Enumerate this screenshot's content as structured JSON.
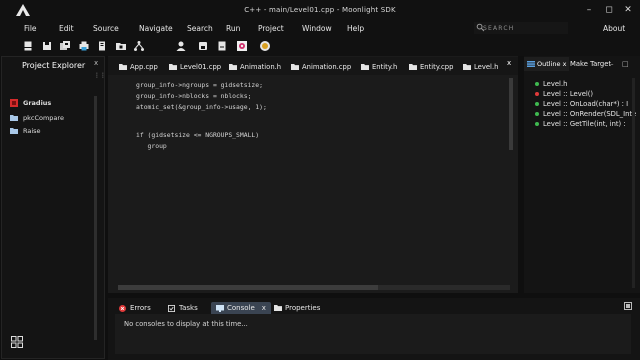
{
  "titlebar": {
    "title": "C++  -  main/Level01.cpp  -  Moonlight SDK",
    "minimize": "–",
    "maximize": "◻",
    "close": "✕"
  },
  "menu": [
    "File",
    "Edit",
    "Source",
    "Navigate",
    "Search",
    "Run",
    "Project",
    "Window",
    "Help"
  ],
  "about": "About",
  "search": {
    "label": "SEARCH"
  },
  "toolbar": {
    "icons": [
      "new-file-icon",
      "save-icon",
      "save-all-icon",
      "print-icon",
      "build-icon",
      "open-folder-icon",
      "hierarchy-icon",
      "user-icon",
      "database-icon",
      "document-icon",
      "plugin-icon",
      "badge-icon"
    ]
  },
  "explorer": {
    "title": "Project Explorer",
    "close": "x",
    "menu": "⋮⋮",
    "items": [
      {
        "label": "Gradius",
        "icon": "project-icon"
      },
      {
        "label": "pkcCompare",
        "icon": "folder-icon"
      },
      {
        "label": "Raise",
        "icon": "folder-icon"
      }
    ]
  },
  "editor": {
    "tabs": [
      "App.cpp",
      "Level01.cpp",
      "Animation.h",
      "Animation.cpp",
      "Entity.h",
      "Entity.cpp",
      "Level.h"
    ],
    "close": "x",
    "code": [
      "group_info->ngroups = gidsetsize;",
      "group_info->nblocks = nblocks;",
      "atomic_set(&group_info->usage, 1);",
      "",
      "",
      "if (gidsetsize <= NGROUPS_SMALL)",
      "   group"
    ]
  },
  "outline": {
    "tab": "Outline x",
    "make_target": "Make Target",
    "min": "–",
    "max": "□",
    "items": [
      {
        "label": "Level.h",
        "color": "#3fb950"
      },
      {
        "label": "Level :: Level()",
        "color": "#e03a3a"
      },
      {
        "label": "Level :: OnLoad(char*)   :   I",
        "color": "#3fb950"
      },
      {
        "label": "Level :: OnRender(SDL_Inte",
        "color": "#3fb950"
      },
      {
        "label": "Level :: GetTile(int, int)   :",
        "color": "#3fb950"
      }
    ]
  },
  "bottom": {
    "tabs": {
      "errors": "Errors",
      "tasks": "Tasks",
      "console": "Console",
      "console_close": "x",
      "properties": "Properties"
    },
    "message": "No consoles to display at this time..."
  },
  "colors": {
    "accent": "#3a4452",
    "error": "#e03a3a",
    "ok": "#3fb950"
  }
}
